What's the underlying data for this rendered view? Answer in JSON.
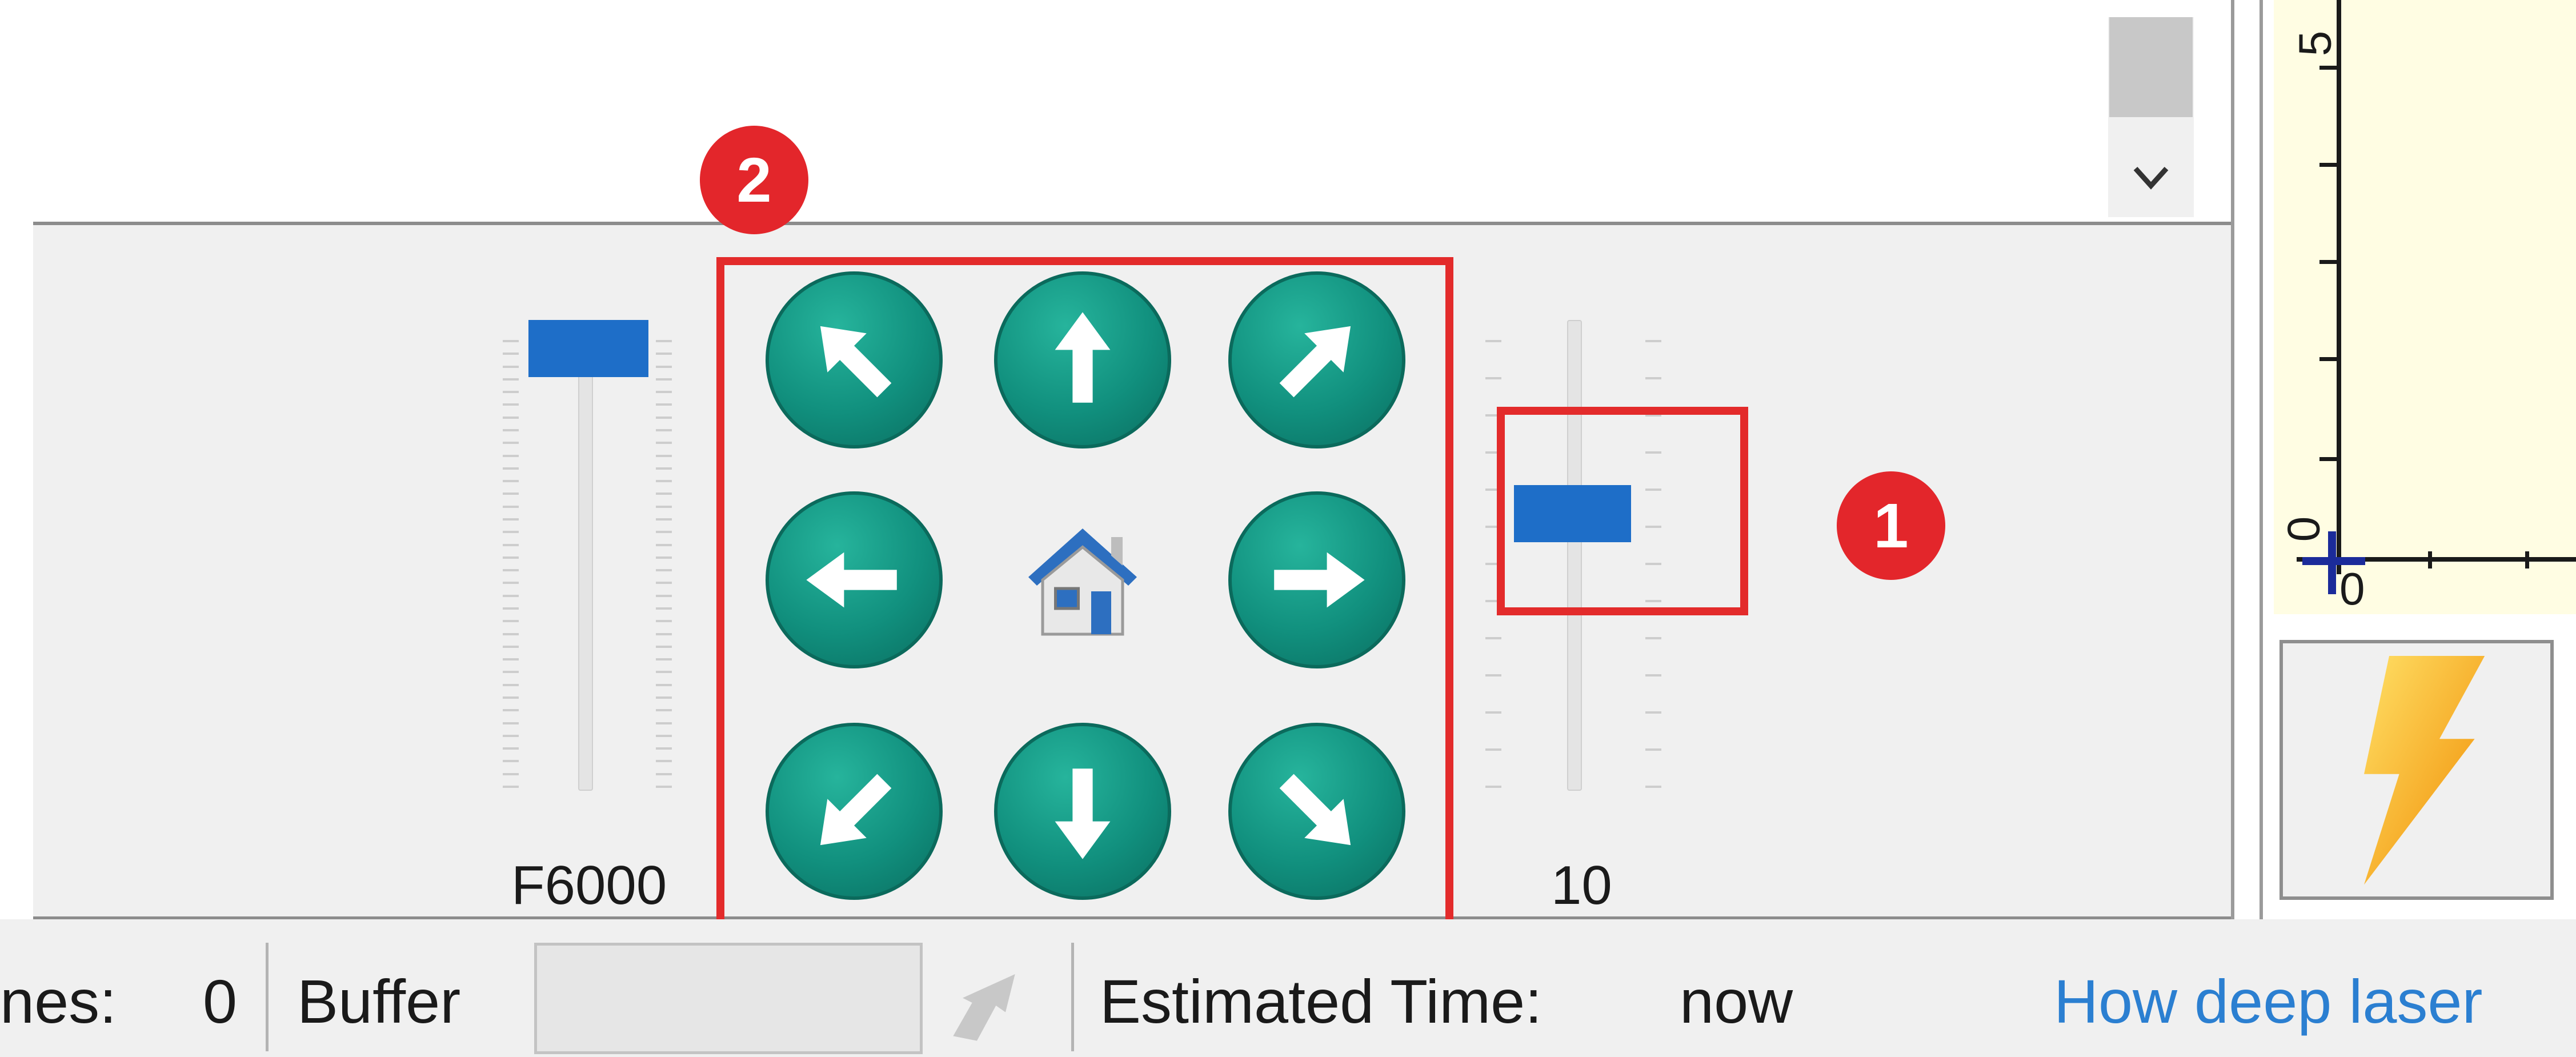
{
  "jog": {
    "speed_label": "F6000",
    "step_label": "10",
    "speed_fraction": 1.0,
    "step_fraction": 0.62,
    "buttons": [
      "up-left",
      "up",
      "up-right",
      "left",
      "home",
      "right",
      "down-left",
      "down",
      "down-right"
    ]
  },
  "markers": {
    "marker_1": "1",
    "marker_2": "2"
  },
  "status": {
    "lines_label": "nes:",
    "lines_value": "0",
    "buffer_label": "Buffer",
    "estimated_label": "Estimated Time:",
    "estimated_value": "now",
    "help_link": "How deep laser"
  },
  "preview": {
    "y_tick_top": "5",
    "y_tick_zero": "0",
    "x_tick_zero": "0"
  },
  "colors": {
    "jog_button": "#11907e",
    "highlight_red": "#e32b2b",
    "slider_thumb": "#1e6ec8",
    "link": "#2b7fd1"
  },
  "icons": {
    "home": "house-icon",
    "laser": "lightning-icon",
    "buffer_send": "send-arrow-icon"
  }
}
